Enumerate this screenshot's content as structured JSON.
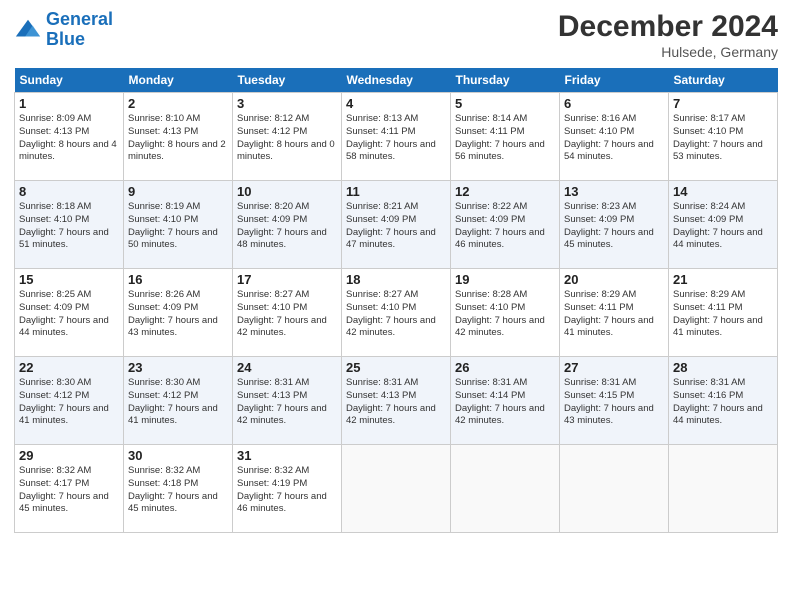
{
  "logo": {
    "line1": "General",
    "line2": "Blue"
  },
  "title": "December 2024",
  "location": "Hulsede, Germany",
  "headers": [
    "Sunday",
    "Monday",
    "Tuesday",
    "Wednesday",
    "Thursday",
    "Friday",
    "Saturday"
  ],
  "weeks": [
    [
      {
        "day": "1",
        "sunrise": "Sunrise: 8:09 AM",
        "sunset": "Sunset: 4:13 PM",
        "daylight": "Daylight: 8 hours and 4 minutes."
      },
      {
        "day": "2",
        "sunrise": "Sunrise: 8:10 AM",
        "sunset": "Sunset: 4:13 PM",
        "daylight": "Daylight: 8 hours and 2 minutes."
      },
      {
        "day": "3",
        "sunrise": "Sunrise: 8:12 AM",
        "sunset": "Sunset: 4:12 PM",
        "daylight": "Daylight: 8 hours and 0 minutes."
      },
      {
        "day": "4",
        "sunrise": "Sunrise: 8:13 AM",
        "sunset": "Sunset: 4:11 PM",
        "daylight": "Daylight: 7 hours and 58 minutes."
      },
      {
        "day": "5",
        "sunrise": "Sunrise: 8:14 AM",
        "sunset": "Sunset: 4:11 PM",
        "daylight": "Daylight: 7 hours and 56 minutes."
      },
      {
        "day": "6",
        "sunrise": "Sunrise: 8:16 AM",
        "sunset": "Sunset: 4:10 PM",
        "daylight": "Daylight: 7 hours and 54 minutes."
      },
      {
        "day": "7",
        "sunrise": "Sunrise: 8:17 AM",
        "sunset": "Sunset: 4:10 PM",
        "daylight": "Daylight: 7 hours and 53 minutes."
      }
    ],
    [
      {
        "day": "8",
        "sunrise": "Sunrise: 8:18 AM",
        "sunset": "Sunset: 4:10 PM",
        "daylight": "Daylight: 7 hours and 51 minutes."
      },
      {
        "day": "9",
        "sunrise": "Sunrise: 8:19 AM",
        "sunset": "Sunset: 4:10 PM",
        "daylight": "Daylight: 7 hours and 50 minutes."
      },
      {
        "day": "10",
        "sunrise": "Sunrise: 8:20 AM",
        "sunset": "Sunset: 4:09 PM",
        "daylight": "Daylight: 7 hours and 48 minutes."
      },
      {
        "day": "11",
        "sunrise": "Sunrise: 8:21 AM",
        "sunset": "Sunset: 4:09 PM",
        "daylight": "Daylight: 7 hours and 47 minutes."
      },
      {
        "day": "12",
        "sunrise": "Sunrise: 8:22 AM",
        "sunset": "Sunset: 4:09 PM",
        "daylight": "Daylight: 7 hours and 46 minutes."
      },
      {
        "day": "13",
        "sunrise": "Sunrise: 8:23 AM",
        "sunset": "Sunset: 4:09 PM",
        "daylight": "Daylight: 7 hours and 45 minutes."
      },
      {
        "day": "14",
        "sunrise": "Sunrise: 8:24 AM",
        "sunset": "Sunset: 4:09 PM",
        "daylight": "Daylight: 7 hours and 44 minutes."
      }
    ],
    [
      {
        "day": "15",
        "sunrise": "Sunrise: 8:25 AM",
        "sunset": "Sunset: 4:09 PM",
        "daylight": "Daylight: 7 hours and 44 minutes."
      },
      {
        "day": "16",
        "sunrise": "Sunrise: 8:26 AM",
        "sunset": "Sunset: 4:09 PM",
        "daylight": "Daylight: 7 hours and 43 minutes."
      },
      {
        "day": "17",
        "sunrise": "Sunrise: 8:27 AM",
        "sunset": "Sunset: 4:10 PM",
        "daylight": "Daylight: 7 hours and 42 minutes."
      },
      {
        "day": "18",
        "sunrise": "Sunrise: 8:27 AM",
        "sunset": "Sunset: 4:10 PM",
        "daylight": "Daylight: 7 hours and 42 minutes."
      },
      {
        "day": "19",
        "sunrise": "Sunrise: 8:28 AM",
        "sunset": "Sunset: 4:10 PM",
        "daylight": "Daylight: 7 hours and 42 minutes."
      },
      {
        "day": "20",
        "sunrise": "Sunrise: 8:29 AM",
        "sunset": "Sunset: 4:11 PM",
        "daylight": "Daylight: 7 hours and 41 minutes."
      },
      {
        "day": "21",
        "sunrise": "Sunrise: 8:29 AM",
        "sunset": "Sunset: 4:11 PM",
        "daylight": "Daylight: 7 hours and 41 minutes."
      }
    ],
    [
      {
        "day": "22",
        "sunrise": "Sunrise: 8:30 AM",
        "sunset": "Sunset: 4:12 PM",
        "daylight": "Daylight: 7 hours and 41 minutes."
      },
      {
        "day": "23",
        "sunrise": "Sunrise: 8:30 AM",
        "sunset": "Sunset: 4:12 PM",
        "daylight": "Daylight: 7 hours and 41 minutes."
      },
      {
        "day": "24",
        "sunrise": "Sunrise: 8:31 AM",
        "sunset": "Sunset: 4:13 PM",
        "daylight": "Daylight: 7 hours and 42 minutes."
      },
      {
        "day": "25",
        "sunrise": "Sunrise: 8:31 AM",
        "sunset": "Sunset: 4:13 PM",
        "daylight": "Daylight: 7 hours and 42 minutes."
      },
      {
        "day": "26",
        "sunrise": "Sunrise: 8:31 AM",
        "sunset": "Sunset: 4:14 PM",
        "daylight": "Daylight: 7 hours and 42 minutes."
      },
      {
        "day": "27",
        "sunrise": "Sunrise: 8:31 AM",
        "sunset": "Sunset: 4:15 PM",
        "daylight": "Daylight: 7 hours and 43 minutes."
      },
      {
        "day": "28",
        "sunrise": "Sunrise: 8:31 AM",
        "sunset": "Sunset: 4:16 PM",
        "daylight": "Daylight: 7 hours and 44 minutes."
      }
    ],
    [
      {
        "day": "29",
        "sunrise": "Sunrise: 8:32 AM",
        "sunset": "Sunset: 4:17 PM",
        "daylight": "Daylight: 7 hours and 45 minutes."
      },
      {
        "day": "30",
        "sunrise": "Sunrise: 8:32 AM",
        "sunset": "Sunset: 4:18 PM",
        "daylight": "Daylight: 7 hours and 45 minutes."
      },
      {
        "day": "31",
        "sunrise": "Sunrise: 8:32 AM",
        "sunset": "Sunset: 4:19 PM",
        "daylight": "Daylight: 7 hours and 46 minutes."
      },
      null,
      null,
      null,
      null
    ]
  ]
}
